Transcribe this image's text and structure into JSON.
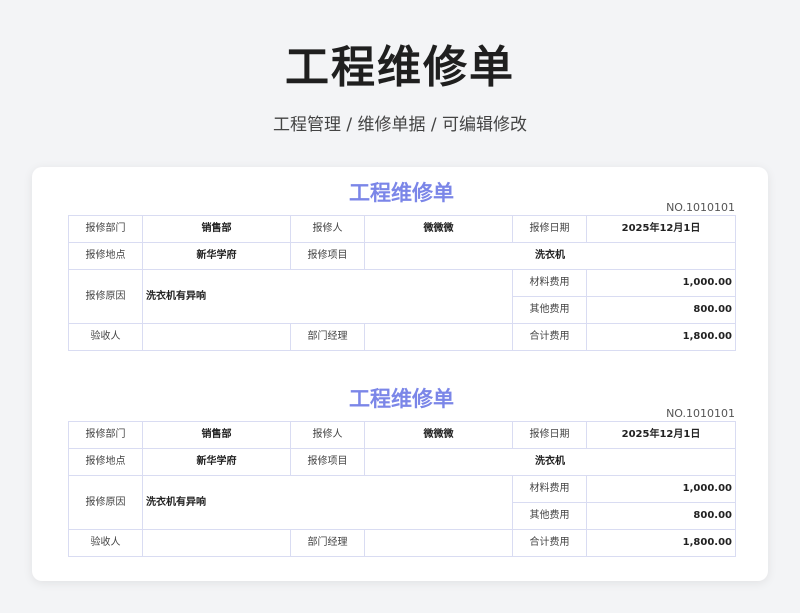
{
  "page": {
    "title": "工程维修单",
    "subtitle": "工程管理 / 维修单据 /  可编辑修改"
  },
  "forms": [
    {
      "title": "工程维修单",
      "number": "NO.1010101",
      "labels": {
        "dept": "报修部门",
        "reporter": "报修人",
        "date": "报修日期",
        "location": "报修地点",
        "item": "报修项目",
        "reason": "报修原因",
        "material_cost": "材料费用",
        "other_cost": "其他费用",
        "acceptor": "验收人",
        "manager": "部门经理",
        "total_cost": "合计费用"
      },
      "values": {
        "dept": "销售部",
        "reporter": "微微微",
        "date": "2025年12月1日",
        "location": "新华学府",
        "item": "洗衣机",
        "reason": "洗衣机有异响",
        "material_cost": "1,000.00",
        "other_cost": "800.00",
        "acceptor": "",
        "manager": "",
        "total_cost": "1,800.00"
      }
    },
    {
      "title": "工程维修单",
      "number": "NO.1010101",
      "labels": {
        "dept": "报修部门",
        "reporter": "报修人",
        "date": "报修日期",
        "location": "报修地点",
        "item": "报修项目",
        "reason": "报修原因",
        "material_cost": "材料费用",
        "other_cost": "其他费用",
        "acceptor": "验收人",
        "manager": "部门经理",
        "total_cost": "合计费用"
      },
      "values": {
        "dept": "销售部",
        "reporter": "微微微",
        "date": "2025年12月1日",
        "location": "新华学府",
        "item": "洗衣机",
        "reason": "洗衣机有异响",
        "material_cost": "1,000.00",
        "other_cost": "800.00",
        "acceptor": "",
        "manager": "",
        "total_cost": "1,800.00"
      }
    }
  ]
}
